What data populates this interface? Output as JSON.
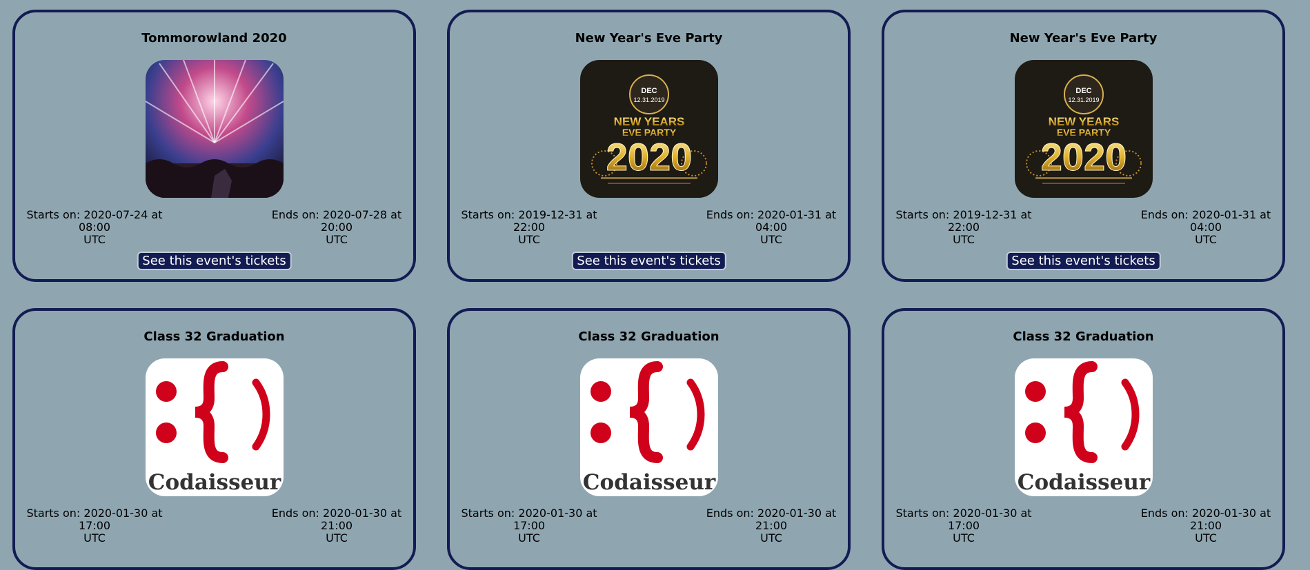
{
  "events": [
    {
      "title": "Tommorowland 2020",
      "start": "Starts on: 2020-07-24 at 08:00",
      "start_tz": "UTC",
      "end": "Ends on: 2020-07-28 at 20:00",
      "end_tz": "UTC",
      "button": "See this event's tickets",
      "image": "concert-photo"
    },
    {
      "title": "New Year's Eve Party",
      "start": "Starts on: 2019-12-31 at 22:00",
      "start_tz": "UTC",
      "end": "Ends on: 2020-01-31 at 04:00",
      "end_tz": "UTC",
      "button": "See this event's tickets",
      "image": "nye-flyer"
    },
    {
      "title": "New Year's Eve Party",
      "start": "Starts on: 2019-12-31 at 22:00",
      "start_tz": "UTC",
      "end": "Ends on: 2020-01-31 at 04:00",
      "end_tz": "UTC",
      "button": "See this event's tickets",
      "image": "nye-flyer"
    },
    {
      "title": "Class 32 Graduation",
      "start": "Starts on: 2020-01-30 at 17:00",
      "start_tz": "UTC",
      "end": "Ends on: 2020-01-30 at 21:00",
      "end_tz": "UTC",
      "image": "codaisseur-logo"
    },
    {
      "title": "Class 32 Graduation",
      "start": "Starts on: 2020-01-30 at 17:00",
      "start_tz": "UTC",
      "end": "Ends on: 2020-01-30 at 21:00",
      "end_tz": "UTC",
      "image": "codaisseur-logo"
    },
    {
      "title": "Class 32 Graduation",
      "start": "Starts on: 2020-01-30 at 17:00",
      "start_tz": "UTC",
      "end": "Ends on: 2020-01-30 at 21:00",
      "end_tz": "UTC",
      "image": "codaisseur-logo"
    }
  ],
  "images": {
    "nye_line1": "NEW YEARS",
    "nye_line2": "EVE PARTY",
    "nye_year": "2020",
    "nye_dec": "DEC",
    "nye_date": "12.31.2019",
    "logo_text": "Codaisseur"
  },
  "colors": {
    "background": "#8fa6b1",
    "border": "#131c52",
    "button": "#131c52",
    "logo_red": "#d0021b"
  }
}
